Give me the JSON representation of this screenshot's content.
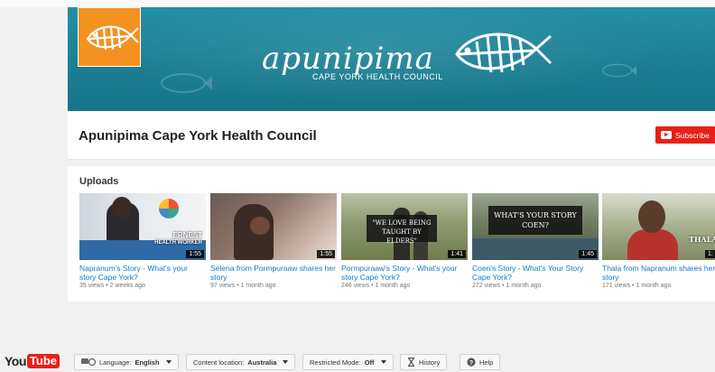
{
  "banner": {
    "logo_text": "apunipima",
    "logo_subtitle": "CAPE YORK HEALTH COUNCIL"
  },
  "channel": {
    "title": "Apunipima Cape York Health Council",
    "subscribe_label": "Subscribe"
  },
  "uploads": {
    "heading": "Uploads",
    "videos": [
      {
        "title": "Napranum's Story - What's your story Cape York?",
        "views": "35 views",
        "age": "2 weeks ago",
        "duration": "1:55",
        "overlay": "ERNEST",
        "overlay2": "HEALTH WORKER"
      },
      {
        "title": "Selena from Pormpuraaw shares her story",
        "views": "97 views",
        "age": "1 month ago",
        "duration": "1:55",
        "overlay": "",
        "overlay2": ""
      },
      {
        "title": "Pormpuraaw's Story - What's your story Cape York?",
        "views": "246 views",
        "age": "1 month ago",
        "duration": "1:41",
        "overlay": "\"WE LOVE BEING",
        "overlay2": "TAUGHT BY ELDERS\""
      },
      {
        "title": "Coen's Story - What's Your Story Cape York?",
        "views": "272 views",
        "age": "1 month ago",
        "duration": "1:45",
        "overlay": "WHAT'S YOUR STORY",
        "overlay2": "COEN?"
      },
      {
        "title": "Thala from Napranum shares her story",
        "views": "171 views",
        "age": "1 month ago",
        "duration": "1:",
        "overlay": "THALA",
        "overlay2": ""
      }
    ]
  },
  "footer": {
    "logo_you": "You",
    "logo_tube": "Tube",
    "language_label": "Language:",
    "language_value": "English",
    "content_location_label": "Content location:",
    "content_location_value": "Australia",
    "restricted_label": "Restricted Mode:",
    "restricted_value": "Off",
    "history_label": "History",
    "help_label": "Help"
  }
}
